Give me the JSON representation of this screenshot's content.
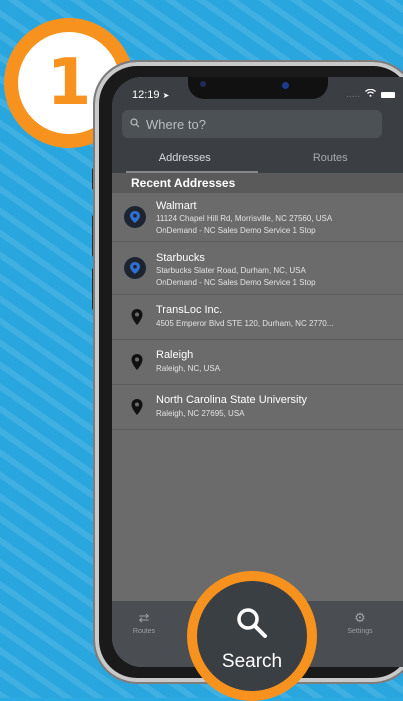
{
  "step": {
    "number": "1"
  },
  "status": {
    "time": "12:19",
    "signal": "....."
  },
  "search": {
    "placeholder": "Where to?"
  },
  "tabs": [
    {
      "label": "Addresses"
    },
    {
      "label": "Routes"
    }
  ],
  "recent": {
    "header": "Recent Addresses",
    "items": [
      {
        "title": "Walmart",
        "line1": "11124 Chapel Hill Rd, Morrisville, NC 27560, USA",
        "line2": "OnDemand - NC Sales Demo Service 1 Stop",
        "icon": "ondemand-icon"
      },
      {
        "title": "Starbucks",
        "line1": "Starbucks Slater Road, Durham, NC, USA",
        "line2": "OnDemand - NC Sales Demo Service 1 Stop",
        "icon": "ondemand-icon"
      },
      {
        "title": "TransLoc Inc.",
        "line1": "4505 Emperor Blvd STE 120, Durham, NC 2770...",
        "icon": "pin-icon"
      },
      {
        "title": "Raleigh",
        "line1": "Raleigh, NC, USA",
        "icon": "pin-icon"
      },
      {
        "title": "North Carolina State University",
        "line1": "Raleigh, NC 27695, USA",
        "icon": "pin-icon"
      }
    ]
  },
  "tabbar": {
    "routes": "Routes",
    "settings": "Settings"
  },
  "search_button": {
    "label": "Search"
  },
  "colors": {
    "accent": "#f7921e",
    "background": "#2aa6df",
    "screen": "#6b6b6b"
  }
}
